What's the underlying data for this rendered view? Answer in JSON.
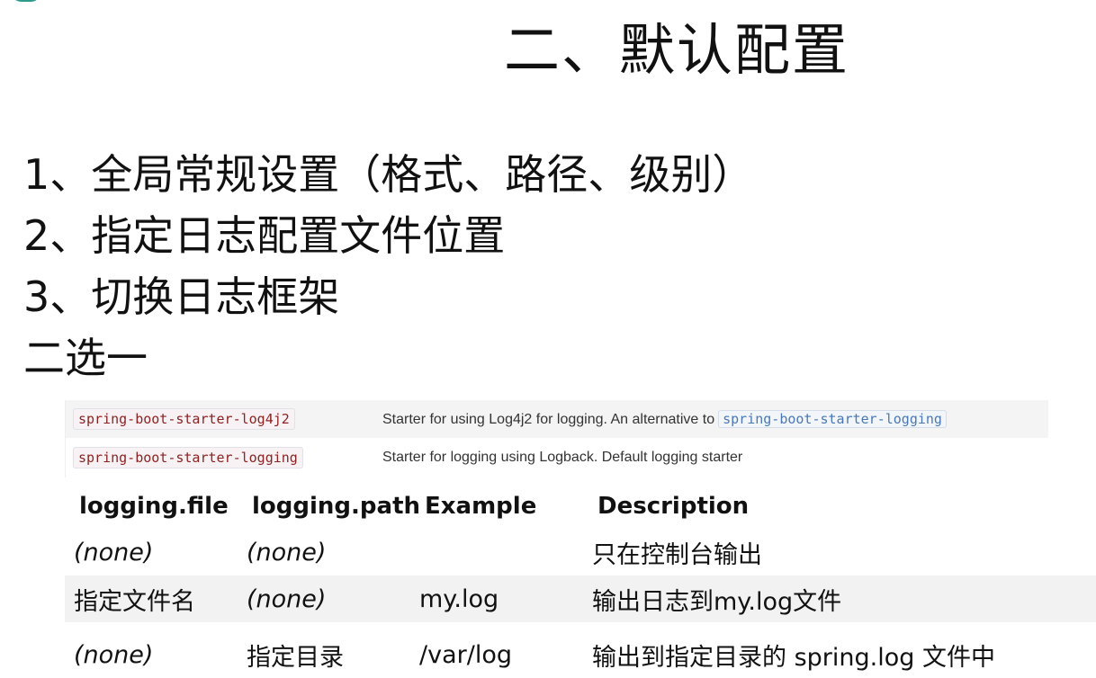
{
  "slide": {
    "title": "二、默认配置",
    "points": [
      "1、全局常规设置（格式、路径、级别）",
      "2、指定日志配置文件位置",
      "3、切换日志框架",
      "二选一"
    ]
  },
  "starters": [
    {
      "name": "spring-boot-starter-log4j2",
      "description": "Starter for using Log4j2 for logging. An alternative to",
      "link": "spring-boot-starter-logging"
    },
    {
      "name": "spring-boot-starter-logging",
      "description": "Starter for logging using Logback. Default logging starter"
    }
  ],
  "config_table": {
    "headers": [
      "logging.file",
      "logging.path",
      "Example",
      "Description"
    ],
    "rows": [
      [
        "(none)",
        "(none)",
        "",
        "只在控制台输出"
      ],
      [
        "指定文件名",
        "(none)",
        "my.log",
        "输出日志到my.log文件"
      ],
      [
        "(none)",
        "指定目录",
        "/var/log",
        "输出到指定目录的 spring.log 文件中"
      ]
    ]
  }
}
